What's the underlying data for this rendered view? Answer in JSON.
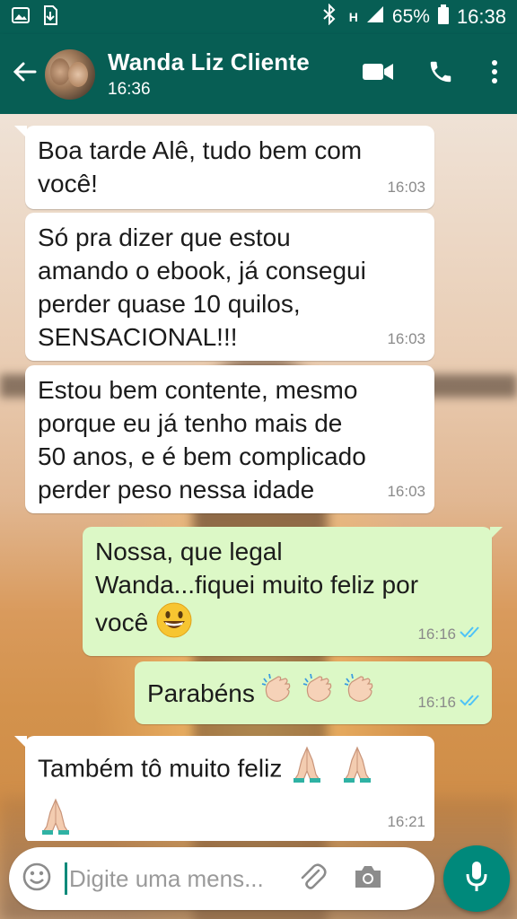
{
  "status_bar": {
    "battery": "65%",
    "time": "16:38",
    "signal_label": "H"
  },
  "header": {
    "contact_name": "Wanda Liz Cliente",
    "contact_status": "16:36"
  },
  "messages": [
    {
      "direction": "in",
      "text_lines": [
        "Boa tarde Alê, tudo bem com",
        "você!"
      ],
      "time": "16:03"
    },
    {
      "direction": "in",
      "text_lines": [
        "Só pra dizer que estou",
        "amando o ebook, já consegui",
        "perder quase 10 quilos,",
        "SENSACIONAL!!!"
      ],
      "time": "16:03"
    },
    {
      "direction": "in",
      "text_lines": [
        "Estou bem contente, mesmo",
        "porque eu já tenho mais de",
        "50 anos, e é bem complicado",
        "perder peso nessa idade"
      ],
      "time": "16:03"
    },
    {
      "direction": "out",
      "text_lines": [
        "Nossa, que legal",
        "Wanda...fiquei muito feliz por",
        "você"
      ],
      "time": "16:16",
      "read": true
    },
    {
      "direction": "out",
      "text_lines": [
        "Parabéns"
      ],
      "time": "16:16",
      "read": true
    },
    {
      "direction": "in",
      "text_lines": [
        "Também tô muito feliz"
      ],
      "time": "16:21"
    }
  ],
  "input": {
    "placeholder": "Digite uma mens..."
  },
  "colors": {
    "header": "#075e54",
    "outgoing_bubble": "#dcf8c6",
    "incoming_bubble": "#ffffff",
    "read_ticks": "#4fc3f7",
    "mic_button": "#00897b"
  },
  "icons": [
    "image-icon",
    "download-icon",
    "bluetooth-icon",
    "signal-icon",
    "battery-icon",
    "back-arrow-icon",
    "video-call-icon",
    "phone-icon",
    "more-vert-icon",
    "smiley-icon",
    "attach-icon",
    "camera-icon",
    "mic-icon",
    "grinning-emoji",
    "clapping-hands-emoji",
    "praying-hands-emoji",
    "double-check-icon"
  ]
}
